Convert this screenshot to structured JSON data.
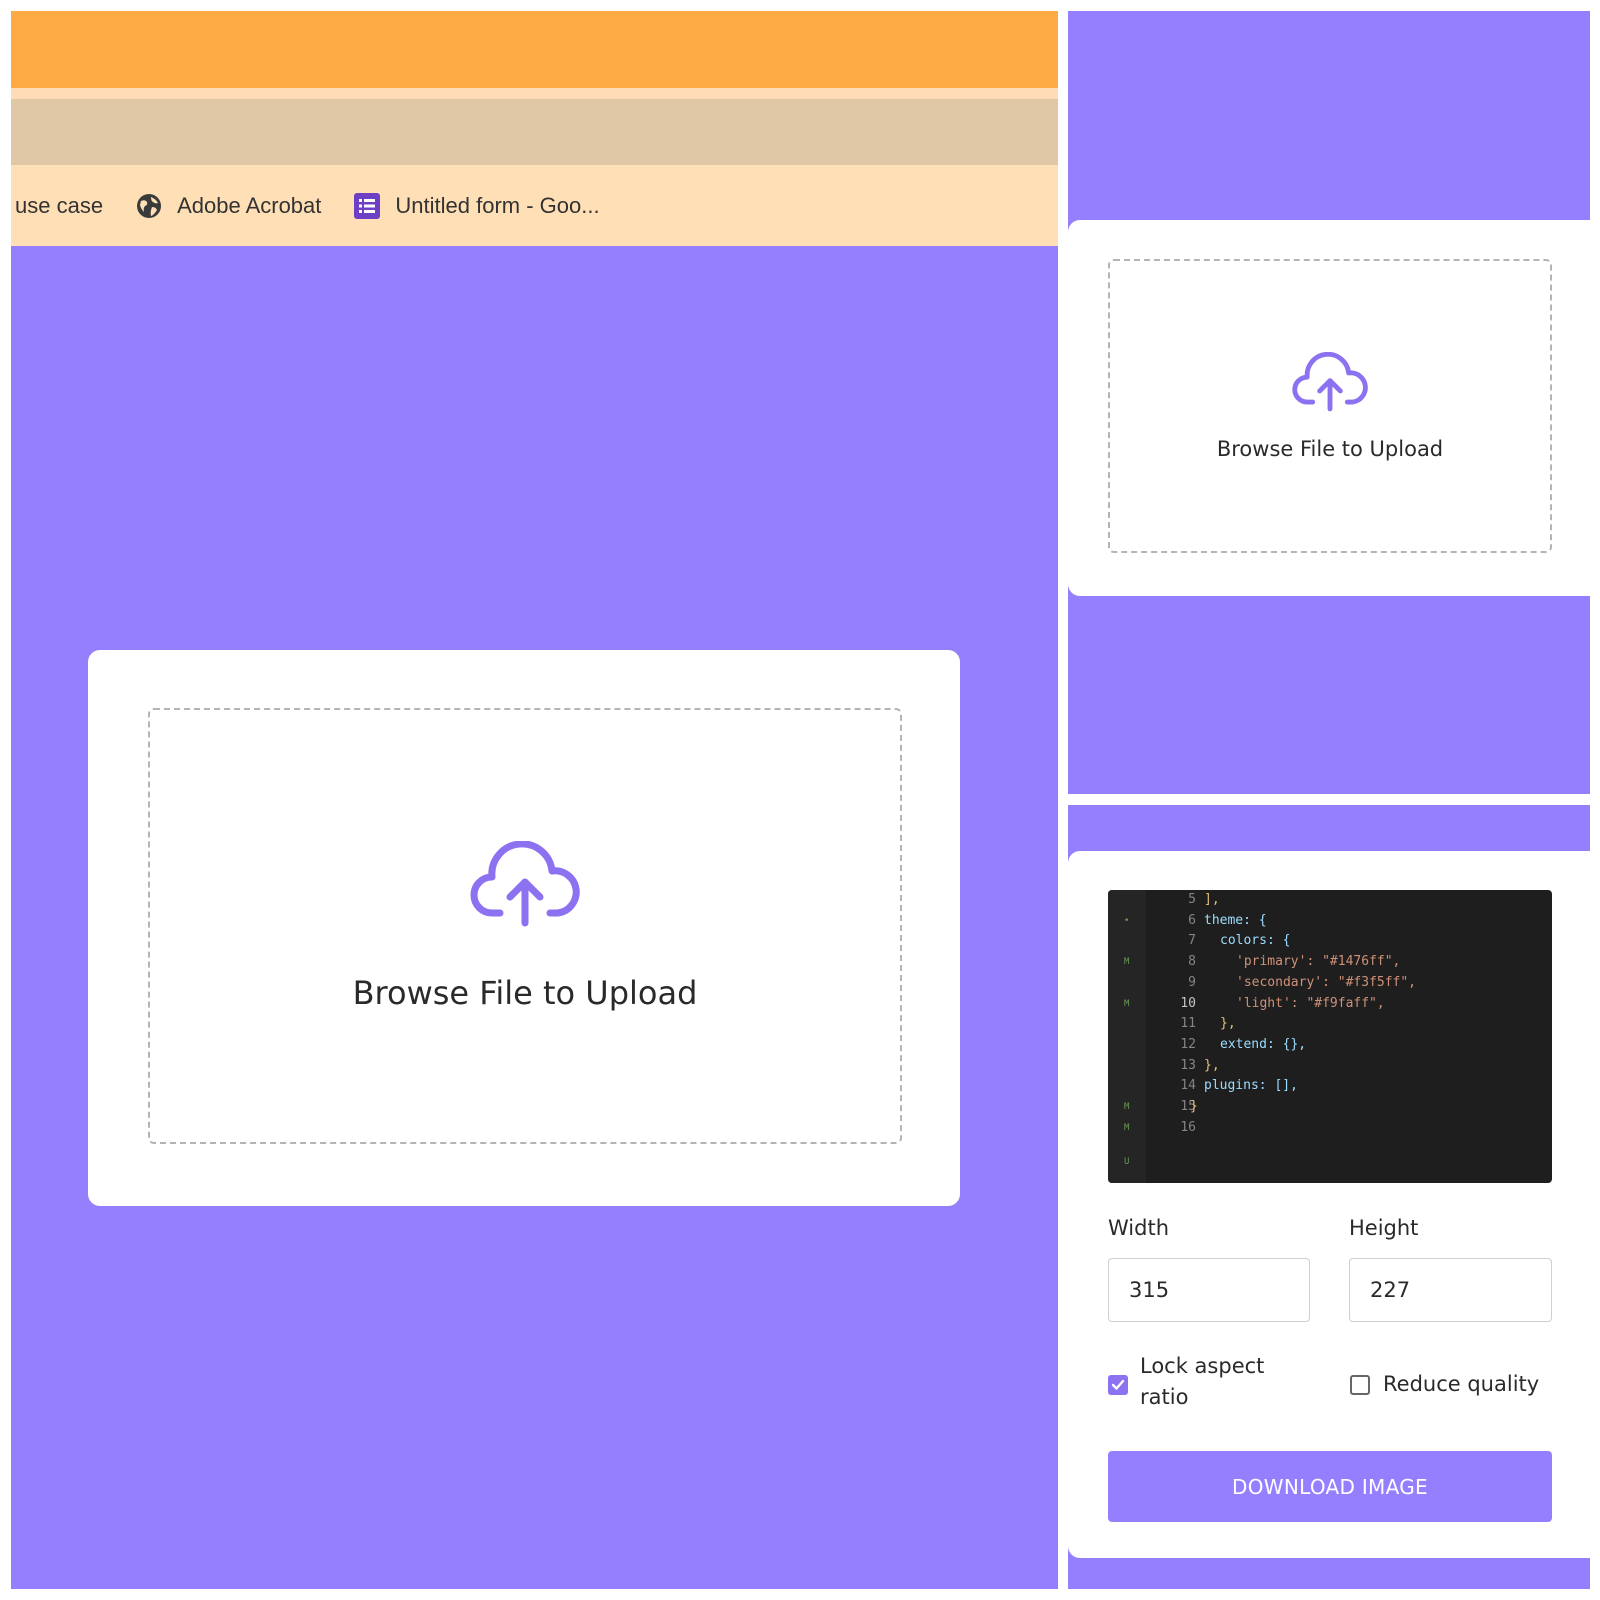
{
  "colors": {
    "accent": "#957fff",
    "orange": "#ffab45",
    "bookmarks_bg": "#ffdfb5",
    "code_bg": "#1e1e1e"
  },
  "bookmarks": [
    {
      "label": "use case",
      "icon": ""
    },
    {
      "label": "Adobe Acrobat",
      "icon": "globe-icon"
    },
    {
      "label": "Untitled form - Goo...",
      "icon": "google-forms-icon"
    }
  ],
  "upload": {
    "label": "Browse File to Upload",
    "icon": "cloud-upload-icon"
  },
  "editor": {
    "lines": [
      {
        "n": "5",
        "text": "],",
        "mark": ""
      },
      {
        "n": "6",
        "text": "theme: {",
        "mark": "•"
      },
      {
        "n": "7",
        "text": "colors: {",
        "mark": ""
      },
      {
        "n": "8",
        "text": "'primary': \"#1476ff\",",
        "mark": "M"
      },
      {
        "n": "9",
        "text": "'secondary': \"#f3f5ff\",",
        "mark": ""
      },
      {
        "n": "10",
        "text": "'light': \"#f9faff\",",
        "mark": "M"
      },
      {
        "n": "11",
        "text": "},",
        "mark": ""
      },
      {
        "n": "12",
        "text": "extend: {},",
        "mark": ""
      },
      {
        "n": "13",
        "text": "},",
        "mark": ""
      },
      {
        "n": "14",
        "text": "plugins: [],",
        "mark": ""
      },
      {
        "n": "15",
        "text": "}",
        "mark": "M"
      },
      {
        "n": "16",
        "text": "",
        "mark": "M"
      }
    ],
    "bottom_mark": "U"
  },
  "resize": {
    "width_label": "Width",
    "width_value": "315",
    "height_label": "Height",
    "height_value": "227",
    "lock_label_line1": "Lock aspect",
    "lock_label_line2": "ratio",
    "lock_checked": true,
    "reduce_label": "Reduce quality",
    "reduce_checked": false,
    "download_label": "DOWNLOAD IMAGE"
  }
}
